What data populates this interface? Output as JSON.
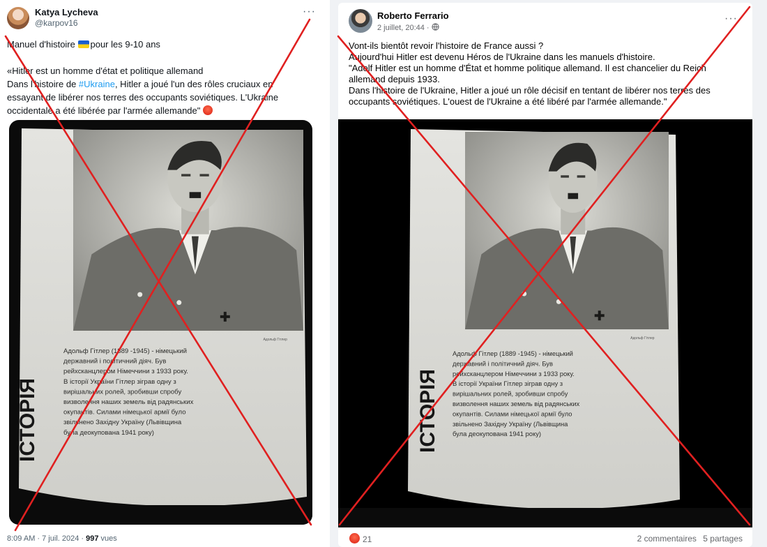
{
  "tweet": {
    "author_name": "Katya Lycheva",
    "handle": "@karpov16",
    "more": "···",
    "line1_a": "Manuel d'histoire ",
    "line1_b": "pour les  9-10 ans",
    "quote_1": "«Hitler est un homme d'état et politique allemand",
    "quote_2_a": "Dans l'histoire de ",
    "quote_2_hashtag": "#Ukraine",
    "quote_2_b": ", Hitler a joué l'un des rôles cruciaux en",
    "quote_3": "essayant de libérer nos terres des occupants soviétiques. L'Ukraine",
    "quote_4": "occidentale a été libérée par l'armée allemande\" ",
    "meta_time": "8:09 AM · 7 juil. 2024 · ",
    "meta_views_count": "997",
    "meta_views_label": " vues"
  },
  "facebook_post": {
    "author_name": "Roberto Ferrario",
    "date": "2 juillet, 20:44 · ",
    "more": "···",
    "text_lines": [
      "Vont-ils bientôt revoir l'histoire de France aussi ?",
      "Aujourd'hui Hitler est devenu Héros de l'Ukraine dans les manuels d'histoire.",
      "\"Adolf Hitler est un homme d'État et homme politique allemand. Il est chancelier du Reich",
      "allemand depuis 1933.",
      "Dans l'histoire de l'Ukraine, Hitler a joué un rôle décisif en tentant de libérer nos terres des",
      "occupants soviétiques. L'ouest de l'Ukraine a été libéré par l'armée allemande.\""
    ],
    "reaction_count": "21",
    "comments": "2 commentaires",
    "shares": "5 partages"
  },
  "textbook_page": {
    "side_title": "ІСТОРІЯ",
    "caption_small": "Адольф Гітлер",
    "body_lines": [
      "Адольф Гітлер (1889 -1945) - німецький",
      "державний і політичний діяч. Був",
      "рейхсканцлером Німеччини з 1933 року.",
      "В історії України Гітлер зіграв одну з",
      "вирішальних ролей, зробивши спробу",
      "визволення наших земель від радянських",
      "окупантів. Силами німецької армії було",
      "звільнено Західну Україну (Львівщина",
      "була деокупована 1941 року)"
    ]
  },
  "colors": {
    "cross": "#e02020",
    "hashtag": "#1d9bf0",
    "facebook_bg": "#f0f2f5"
  }
}
